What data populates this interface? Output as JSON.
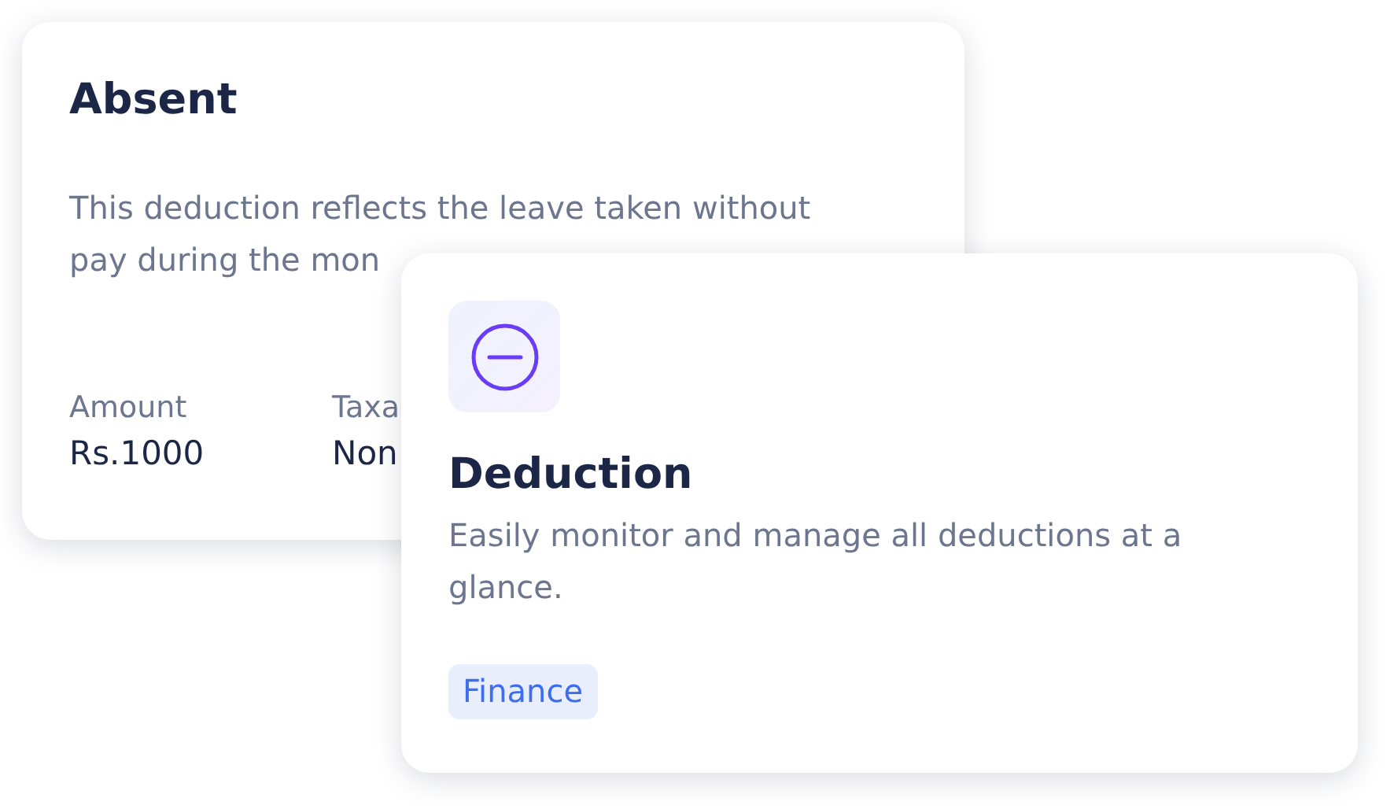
{
  "back_card": {
    "title": "Absent",
    "description_lines": [
      "This deduction reflects the leave taken without",
      "pay during the mon"
    ],
    "fields": [
      {
        "label": "Amount",
        "value": "Rs.1000"
      },
      {
        "label": "Taxa",
        "value": "Non"
      }
    ]
  },
  "front_card": {
    "title": "Deduction",
    "description": "Easily monitor and manage all deductions at a glance.",
    "tag": "Finance"
  }
}
